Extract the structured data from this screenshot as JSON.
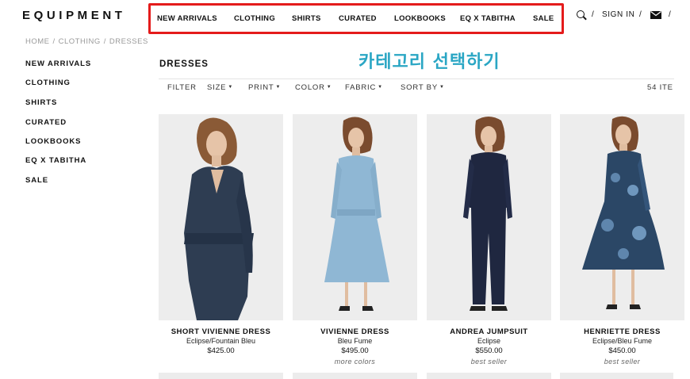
{
  "brand": {
    "logo": "EQUIPMENT"
  },
  "top_nav": [
    {
      "label": "NEW ARRIVALS"
    },
    {
      "label": "CLOTHING"
    },
    {
      "label": "SHIRTS"
    },
    {
      "label": "CURATED"
    },
    {
      "label": "LOOKBOOKS"
    },
    {
      "label": "EQ X TABITHA"
    },
    {
      "label": "SALE"
    }
  ],
  "utility": {
    "separator": "/",
    "sign_in": "SIGN IN"
  },
  "breadcrumb": {
    "items": [
      "HOME",
      "CLOTHING",
      "DRESSES"
    ],
    "separator": "/"
  },
  "sidebar": {
    "items": [
      {
        "label": "NEW ARRIVALS"
      },
      {
        "label": "CLOTHING"
      },
      {
        "label": "SHIRTS"
      },
      {
        "label": "CURATED"
      },
      {
        "label": "LOOKBOOKS"
      },
      {
        "label": "EQ X TABITHA"
      },
      {
        "label": "SALE"
      }
    ]
  },
  "page": {
    "title": "DRESSES"
  },
  "annotation": {
    "text": "카테고리 선택하기",
    "color": "#2aa6c4"
  },
  "highlight_color": "#e41b1b",
  "filters": {
    "filter_label": "FILTER",
    "dropdowns": [
      "SIZE",
      "PRINT",
      "COLOR",
      "FABRIC",
      "SORT BY"
    ],
    "count": "54 ITE"
  },
  "products": [
    {
      "name": "SHORT VIVIENNE DRESS",
      "color": "Eclipse/Fountain Bleu",
      "price": "$425.00",
      "tag": "",
      "garment_color": "#2e3d52"
    },
    {
      "name": "VIVIENNE DRESS",
      "color": "Bleu Fume",
      "price": "$495.00",
      "tag": "more colors",
      "garment_color": "#8fb7d4"
    },
    {
      "name": "ANDREA JUMPSUIT",
      "color": "Eclipse",
      "price": "$550.00",
      "tag": "best seller",
      "garment_color": "#1f2740"
    },
    {
      "name": "HENRIETTE DRESS",
      "color": "Eclipse/Bleu Fume",
      "price": "$450.00",
      "tag": "best seller",
      "garment_color": "#2b4766"
    }
  ]
}
